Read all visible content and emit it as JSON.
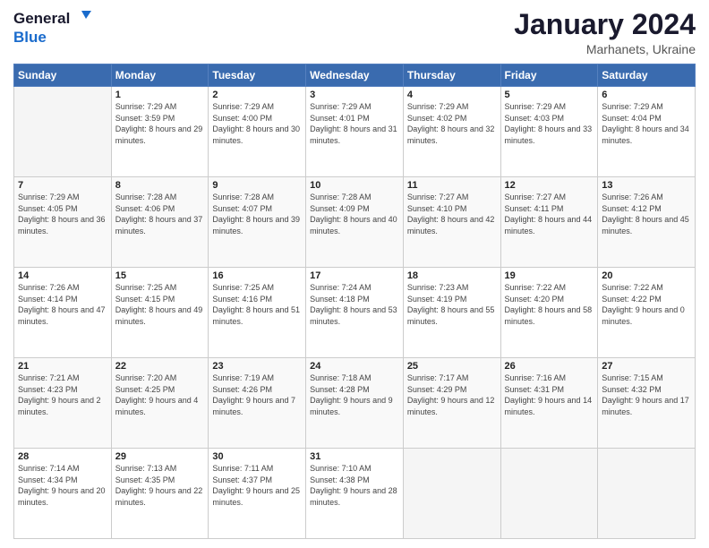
{
  "header": {
    "logo_line1": "General",
    "logo_line2": "Blue",
    "title": "January 2024",
    "subtitle": "Marhanets, Ukraine"
  },
  "weekdays": [
    "Sunday",
    "Monday",
    "Tuesday",
    "Wednesday",
    "Thursday",
    "Friday",
    "Saturday"
  ],
  "weeks": [
    [
      {
        "day": null
      },
      {
        "day": "1",
        "sunrise": "7:29 AM",
        "sunset": "3:59 PM",
        "daylight": "8 hours and 29 minutes."
      },
      {
        "day": "2",
        "sunrise": "7:29 AM",
        "sunset": "4:00 PM",
        "daylight": "8 hours and 30 minutes."
      },
      {
        "day": "3",
        "sunrise": "7:29 AM",
        "sunset": "4:01 PM",
        "daylight": "8 hours and 31 minutes."
      },
      {
        "day": "4",
        "sunrise": "7:29 AM",
        "sunset": "4:02 PM",
        "daylight": "8 hours and 32 minutes."
      },
      {
        "day": "5",
        "sunrise": "7:29 AM",
        "sunset": "4:03 PM",
        "daylight": "8 hours and 33 minutes."
      },
      {
        "day": "6",
        "sunrise": "7:29 AM",
        "sunset": "4:04 PM",
        "daylight": "8 hours and 34 minutes."
      }
    ],
    [
      {
        "day": "7",
        "sunrise": "7:29 AM",
        "sunset": "4:05 PM",
        "daylight": "8 hours and 36 minutes."
      },
      {
        "day": "8",
        "sunrise": "7:28 AM",
        "sunset": "4:06 PM",
        "daylight": "8 hours and 37 minutes."
      },
      {
        "day": "9",
        "sunrise": "7:28 AM",
        "sunset": "4:07 PM",
        "daylight": "8 hours and 39 minutes."
      },
      {
        "day": "10",
        "sunrise": "7:28 AM",
        "sunset": "4:09 PM",
        "daylight": "8 hours and 40 minutes."
      },
      {
        "day": "11",
        "sunrise": "7:27 AM",
        "sunset": "4:10 PM",
        "daylight": "8 hours and 42 minutes."
      },
      {
        "day": "12",
        "sunrise": "7:27 AM",
        "sunset": "4:11 PM",
        "daylight": "8 hours and 44 minutes."
      },
      {
        "day": "13",
        "sunrise": "7:26 AM",
        "sunset": "4:12 PM",
        "daylight": "8 hours and 45 minutes."
      }
    ],
    [
      {
        "day": "14",
        "sunrise": "7:26 AM",
        "sunset": "4:14 PM",
        "daylight": "8 hours and 47 minutes."
      },
      {
        "day": "15",
        "sunrise": "7:25 AM",
        "sunset": "4:15 PM",
        "daylight": "8 hours and 49 minutes."
      },
      {
        "day": "16",
        "sunrise": "7:25 AM",
        "sunset": "4:16 PM",
        "daylight": "8 hours and 51 minutes."
      },
      {
        "day": "17",
        "sunrise": "7:24 AM",
        "sunset": "4:18 PM",
        "daylight": "8 hours and 53 minutes."
      },
      {
        "day": "18",
        "sunrise": "7:23 AM",
        "sunset": "4:19 PM",
        "daylight": "8 hours and 55 minutes."
      },
      {
        "day": "19",
        "sunrise": "7:22 AM",
        "sunset": "4:20 PM",
        "daylight": "8 hours and 58 minutes."
      },
      {
        "day": "20",
        "sunrise": "7:22 AM",
        "sunset": "4:22 PM",
        "daylight": "9 hours and 0 minutes."
      }
    ],
    [
      {
        "day": "21",
        "sunrise": "7:21 AM",
        "sunset": "4:23 PM",
        "daylight": "9 hours and 2 minutes."
      },
      {
        "day": "22",
        "sunrise": "7:20 AM",
        "sunset": "4:25 PM",
        "daylight": "9 hours and 4 minutes."
      },
      {
        "day": "23",
        "sunrise": "7:19 AM",
        "sunset": "4:26 PM",
        "daylight": "9 hours and 7 minutes."
      },
      {
        "day": "24",
        "sunrise": "7:18 AM",
        "sunset": "4:28 PM",
        "daylight": "9 hours and 9 minutes."
      },
      {
        "day": "25",
        "sunrise": "7:17 AM",
        "sunset": "4:29 PM",
        "daylight": "9 hours and 12 minutes."
      },
      {
        "day": "26",
        "sunrise": "7:16 AM",
        "sunset": "4:31 PM",
        "daylight": "9 hours and 14 minutes."
      },
      {
        "day": "27",
        "sunrise": "7:15 AM",
        "sunset": "4:32 PM",
        "daylight": "9 hours and 17 minutes."
      }
    ],
    [
      {
        "day": "28",
        "sunrise": "7:14 AM",
        "sunset": "4:34 PM",
        "daylight": "9 hours and 20 minutes."
      },
      {
        "day": "29",
        "sunrise": "7:13 AM",
        "sunset": "4:35 PM",
        "daylight": "9 hours and 22 minutes."
      },
      {
        "day": "30",
        "sunrise": "7:11 AM",
        "sunset": "4:37 PM",
        "daylight": "9 hours and 25 minutes."
      },
      {
        "day": "31",
        "sunrise": "7:10 AM",
        "sunset": "4:38 PM",
        "daylight": "9 hours and 28 minutes."
      },
      {
        "day": null
      },
      {
        "day": null
      },
      {
        "day": null
      }
    ]
  ]
}
